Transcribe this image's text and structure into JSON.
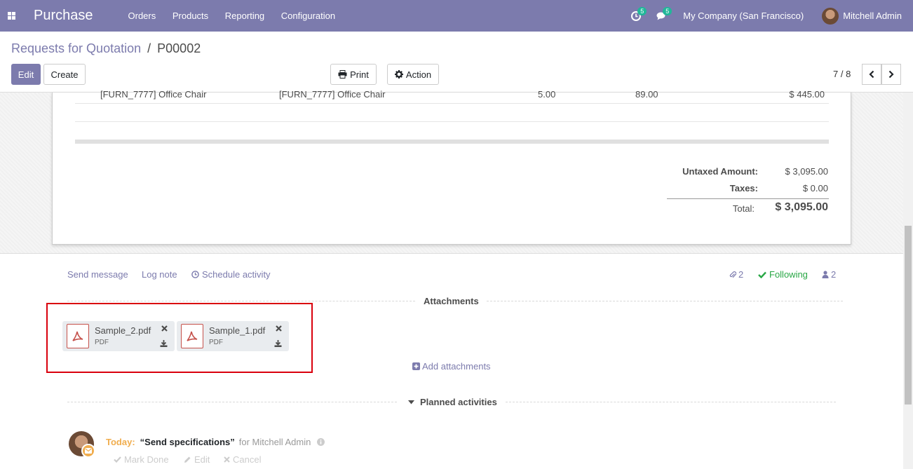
{
  "navbar": {
    "app_name": "Purchase",
    "menu": [
      "Orders",
      "Products",
      "Reporting",
      "Configuration"
    ],
    "activity_count": "5",
    "message_count": "5",
    "company": "My Company (San Francisco)",
    "user": "Mitchell Admin"
  },
  "control_panel": {
    "breadcrumb_parent": "Requests for Quotation",
    "breadcrumb_sep": "/",
    "breadcrumb_current": "P00002",
    "edit_label": "Edit",
    "create_label": "Create",
    "print_label": "Print",
    "action_label": "Action",
    "pager": "7 / 8"
  },
  "order_line": {
    "product": "[FURN_7777] Office Chair",
    "description": "[FURN_7777] Office Chair",
    "quantity": "5.00",
    "unit_price": "89.00",
    "subtotal": "$ 445.00"
  },
  "totals": {
    "untaxed_label": "Untaxed Amount:",
    "untaxed_value": "$ 3,095.00",
    "taxes_label": "Taxes:",
    "taxes_value": "$ 0.00",
    "total_label": "Total:",
    "total_value": "$ 3,095.00"
  },
  "chatter": {
    "send_message": "Send message",
    "log_note": "Log note",
    "schedule_activity": "Schedule activity",
    "attachment_count": "2",
    "following": "Following",
    "follower_count": "2",
    "attachments_title": "Attachments",
    "attachments": [
      {
        "name": "Sample_2.pdf",
        "type": "PDF"
      },
      {
        "name": "Sample_1.pdf",
        "type": "PDF"
      }
    ],
    "add_attachments": "Add attachments",
    "planned_title": "Planned activities",
    "activity": {
      "when": "Today:",
      "summary": "“Send specifications”",
      "assignee": "for Mitchell Admin",
      "mark_done": "Mark Done",
      "edit": "Edit",
      "cancel": "Cancel"
    }
  },
  "colors": {
    "brand": "#7c7bad",
    "badge": "#21b799",
    "following": "#28a745",
    "today": "#f0ad4e",
    "highlight_box": "#d9000d"
  }
}
